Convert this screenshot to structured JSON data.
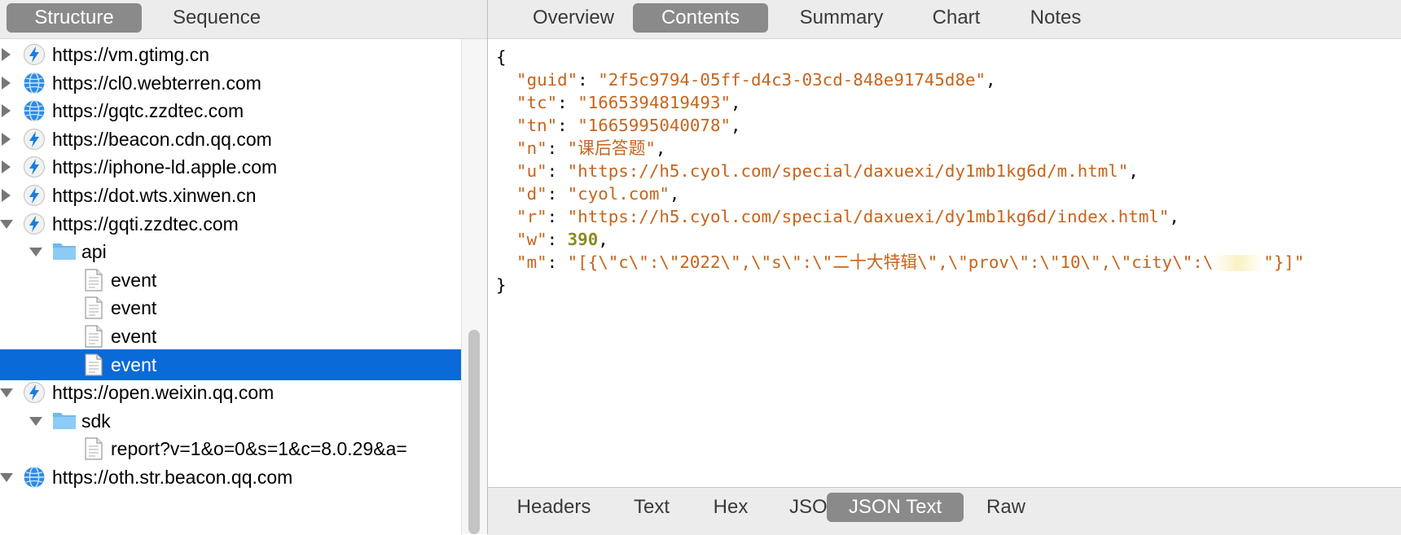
{
  "left_tabs": {
    "structure": "Structure",
    "sequence": "Sequence"
  },
  "tree": [
    {
      "label": "https://vm.gtimg.cn",
      "icon": "lightning-icon"
    },
    {
      "label": "https://cl0.webterren.com",
      "icon": "globe-icon"
    },
    {
      "label": "https://gqtc.zzdtec.com",
      "icon": "globe-icon"
    },
    {
      "label": "https://beacon.cdn.qq.com",
      "icon": "lightning-icon"
    },
    {
      "label": "https://iphone-ld.apple.com",
      "icon": "lightning-icon"
    },
    {
      "label": "https://dot.wts.xinwen.cn",
      "icon": "lightning-icon"
    },
    {
      "label": "https://gqti.zzdtec.com",
      "icon": "lightning-icon"
    },
    {
      "label": "api",
      "icon": "folder-icon"
    },
    {
      "label": "event",
      "icon": "document-icon"
    },
    {
      "label": "event",
      "icon": "document-icon"
    },
    {
      "label": "event",
      "icon": "document-icon"
    },
    {
      "label": "event",
      "icon": "document-icon"
    },
    {
      "label": "https://open.weixin.qq.com",
      "icon": "lightning-icon"
    },
    {
      "label": "sdk",
      "icon": "folder-icon"
    },
    {
      "label": "report?v=1&o=0&s=1&c=8.0.29&a=",
      "icon": "document-icon"
    },
    {
      "label": "https://oth.str.beacon.qq.com",
      "icon": "globe-icon"
    }
  ],
  "right_tabs": {
    "overview": "Overview",
    "contents": "Contents",
    "summary": "Summary",
    "chart": "Chart",
    "notes": "Notes"
  },
  "json": {
    "open": "{",
    "close": "}",
    "guid_key": "\"guid\"",
    "guid_val": "\"2f5c9794-05ff-d4c3-03cd-848e91745d8e\"",
    "tc_key": "\"tc\"",
    "tc_val": "\"1665394819493\"",
    "tn_key": "\"tn\"",
    "tn_val": "\"1665995040078\"",
    "n_key": "\"n\"",
    "n_val": "\"课后答题\"",
    "u_key": "\"u\"",
    "u_val": "\"https://h5.cyol.com/special/daxuexi/dy1mb1kg6d/m.html\"",
    "d_key": "\"d\"",
    "d_val": "\"cyol.com\"",
    "r_key": "\"r\"",
    "r_val": "\"https://h5.cyol.com/special/daxuexi/dy1mb1kg6d/index.html\"",
    "w_key": "\"w\"",
    "w_val": "390",
    "m_key": "\"m\"",
    "m_val_start": "\"[{\\\"c\\\":\\\"2022\\\",\\\"s\\\":\\\"二十大特辑\\\",\\\"prov\\\":\\\"10\\\",\\\"city\\\":\\",
    "m_val_end": "\"}]\""
  },
  "bottom_tabs": {
    "headers": "Headers",
    "text": "Text",
    "hex": "Hex",
    "json": "JSON",
    "json_text": "JSON Text",
    "raw": "Raw"
  },
  "colors": {
    "selection": "#0a6ad8",
    "json_string": "#c8641c",
    "json_number": "#8a8a1e",
    "active_tab": "#8a8a8a",
    "globe": "#2f8be6",
    "lightning": "#1a7de0"
  }
}
